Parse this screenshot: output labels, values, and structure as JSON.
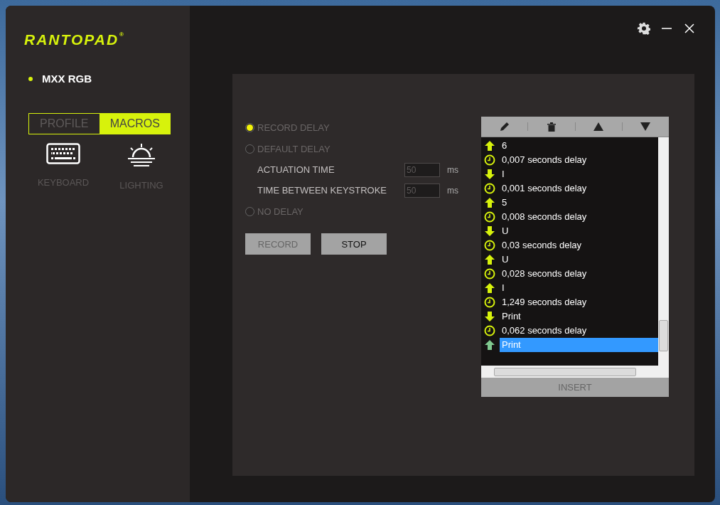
{
  "brand": {
    "logo": "RANTOPAD",
    "mark": "®"
  },
  "device": {
    "name": "MXX RGB"
  },
  "tabs": [
    {
      "label": "PROFILE",
      "selected": false
    },
    {
      "label": "MACROS",
      "selected": true
    }
  ],
  "modules": [
    {
      "kind": "keyboard",
      "label": "KEYBOARD"
    },
    {
      "kind": "lighting",
      "label": "LIGHTING"
    }
  ],
  "delay_options": [
    {
      "label": "RECORD DELAY",
      "selected": true
    },
    {
      "label": "DEFAULT DELAY",
      "selected": false,
      "fields": [
        {
          "label": "ACTUATION TIME",
          "value": "50",
          "unit": "ms"
        },
        {
          "label": "TIME BETWEEN KEYSTROKE",
          "value": "50",
          "unit": "ms"
        }
      ]
    },
    {
      "label": "NO DELAY",
      "selected": false
    }
  ],
  "buttons": [
    {
      "label": "RECORD",
      "disabled": true
    },
    {
      "label": "STOP",
      "disabled": false
    }
  ],
  "macro_list": {
    "events": [
      {
        "kind": "up",
        "text": "6",
        "selected": false
      },
      {
        "kind": "delay",
        "text": "0,007 seconds delay",
        "selected": false
      },
      {
        "kind": "down",
        "text": "I",
        "selected": false
      },
      {
        "kind": "delay",
        "text": "0,001 seconds delay",
        "selected": false
      },
      {
        "kind": "up",
        "text": "5",
        "selected": false
      },
      {
        "kind": "delay",
        "text": "0,008 seconds delay",
        "selected": false
      },
      {
        "kind": "down",
        "text": "U",
        "selected": false
      },
      {
        "kind": "delay",
        "text": "0,03 seconds delay",
        "selected": false
      },
      {
        "kind": "up",
        "text": "U",
        "selected": false
      },
      {
        "kind": "delay",
        "text": "0,028 seconds delay",
        "selected": false
      },
      {
        "kind": "up",
        "text": "I",
        "selected": false
      },
      {
        "kind": "delay",
        "text": "1,249 seconds delay",
        "selected": false
      },
      {
        "kind": "down",
        "text": "Print",
        "selected": false
      },
      {
        "kind": "delay",
        "text": "0,062 seconds delay",
        "selected": false
      },
      {
        "kind": "up",
        "text": "Print",
        "selected": true
      }
    ],
    "insert_button": "INSERT"
  }
}
